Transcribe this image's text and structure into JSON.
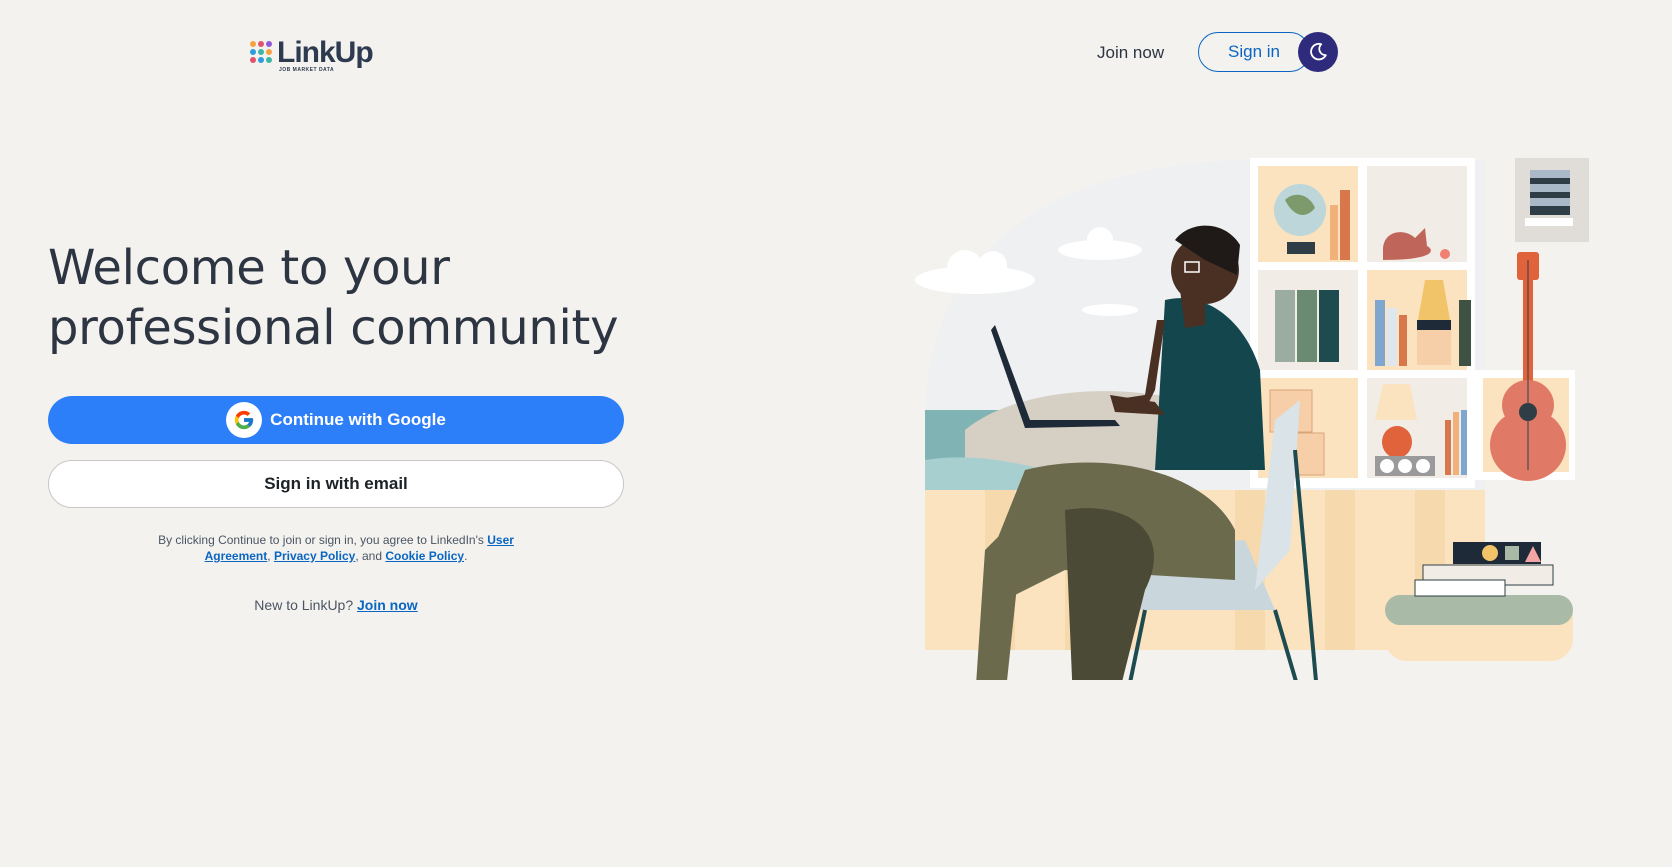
{
  "header": {
    "logo": {
      "name": "LinkUp",
      "tagline": "JOB MARKET DATA",
      "dot_colors": [
        "#f4a340",
        "#e2536b",
        "#8f5ad8",
        "#2f9bd9",
        "#3bb7a8",
        "#f4a340",
        "#e2536b",
        "#2f9bd9",
        "#3bb7a8"
      ]
    },
    "join_now_label": "Join now",
    "sign_in_label": "Sign in",
    "theme_toggle_icon": "moon-icon"
  },
  "main": {
    "headline_line1": "Welcome to your",
    "headline_line2": "professional community",
    "google_button_label": "Continue with Google",
    "google_icon": "google-g-icon",
    "email_button_label": "Sign in with email",
    "terms": {
      "prefix": "By clicking Continue to join or sign in, you agree to LinkedIn's ",
      "user_agreement": "User Agreement",
      "sep1": ", ",
      "privacy_policy": "Privacy Policy",
      "sep2": ", and ",
      "cookie_policy": "Cookie Policy",
      "suffix": "."
    },
    "new_to_prefix": "New to LinkUp? ",
    "new_to_link": "Join now"
  },
  "illustration": {
    "name": "person-working-on-laptop-illustration"
  },
  "colors": {
    "background": "#f3f2ef",
    "primary_blue": "#2d7ff9",
    "link_blue": "#0a66c2",
    "theme_button": "#2e2a7c",
    "heading_text": "#2d3542"
  }
}
